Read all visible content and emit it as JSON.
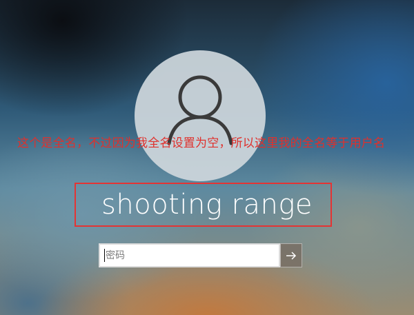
{
  "user": {
    "display_name": "shooting range",
    "avatar_icon": "user-silhouette-icon"
  },
  "annotation": {
    "text": "这个是全名，不过因为我全名设置为空，所以这里我的全名等于用户名",
    "color": "#e0302c"
  },
  "password": {
    "placeholder": "密码",
    "value": ""
  },
  "submit": {
    "icon": "arrow-right-icon"
  },
  "colors": {
    "highlight": "#e53333",
    "text": "#ffffff"
  }
}
